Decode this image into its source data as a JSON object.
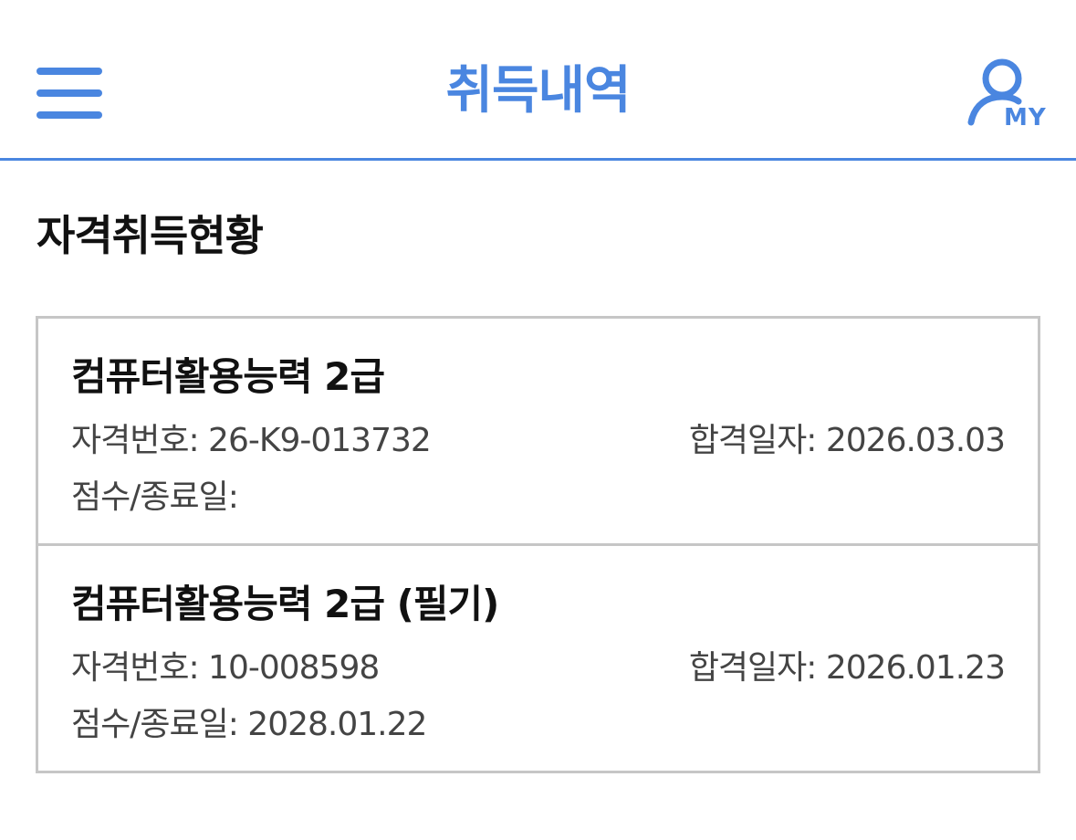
{
  "colors": {
    "accent": "#4a86e0",
    "text_primary": "#111111",
    "text_secondary": "#444444",
    "border": "#c6c6c6"
  },
  "header": {
    "menu_icon": "hamburger-menu-icon",
    "title": "취득내역",
    "my_icon": "user-profile-icon",
    "my_label": "MY"
  },
  "section": {
    "title": "자격취득현황"
  },
  "certificates": [
    {
      "name": "컴퓨터활용능력 2급",
      "number_label": "자격번호: 26-K9-013732",
      "pass_date_label": "합격일자: 2026.03.03",
      "score_label": "점수/종료일:"
    },
    {
      "name": "컴퓨터활용능력 2급 (필기)",
      "number_label": "자격번호: 10-008598",
      "pass_date_label": "합격일자: 2026.01.23",
      "score_label": "점수/종료일: 2028.01.22"
    }
  ]
}
